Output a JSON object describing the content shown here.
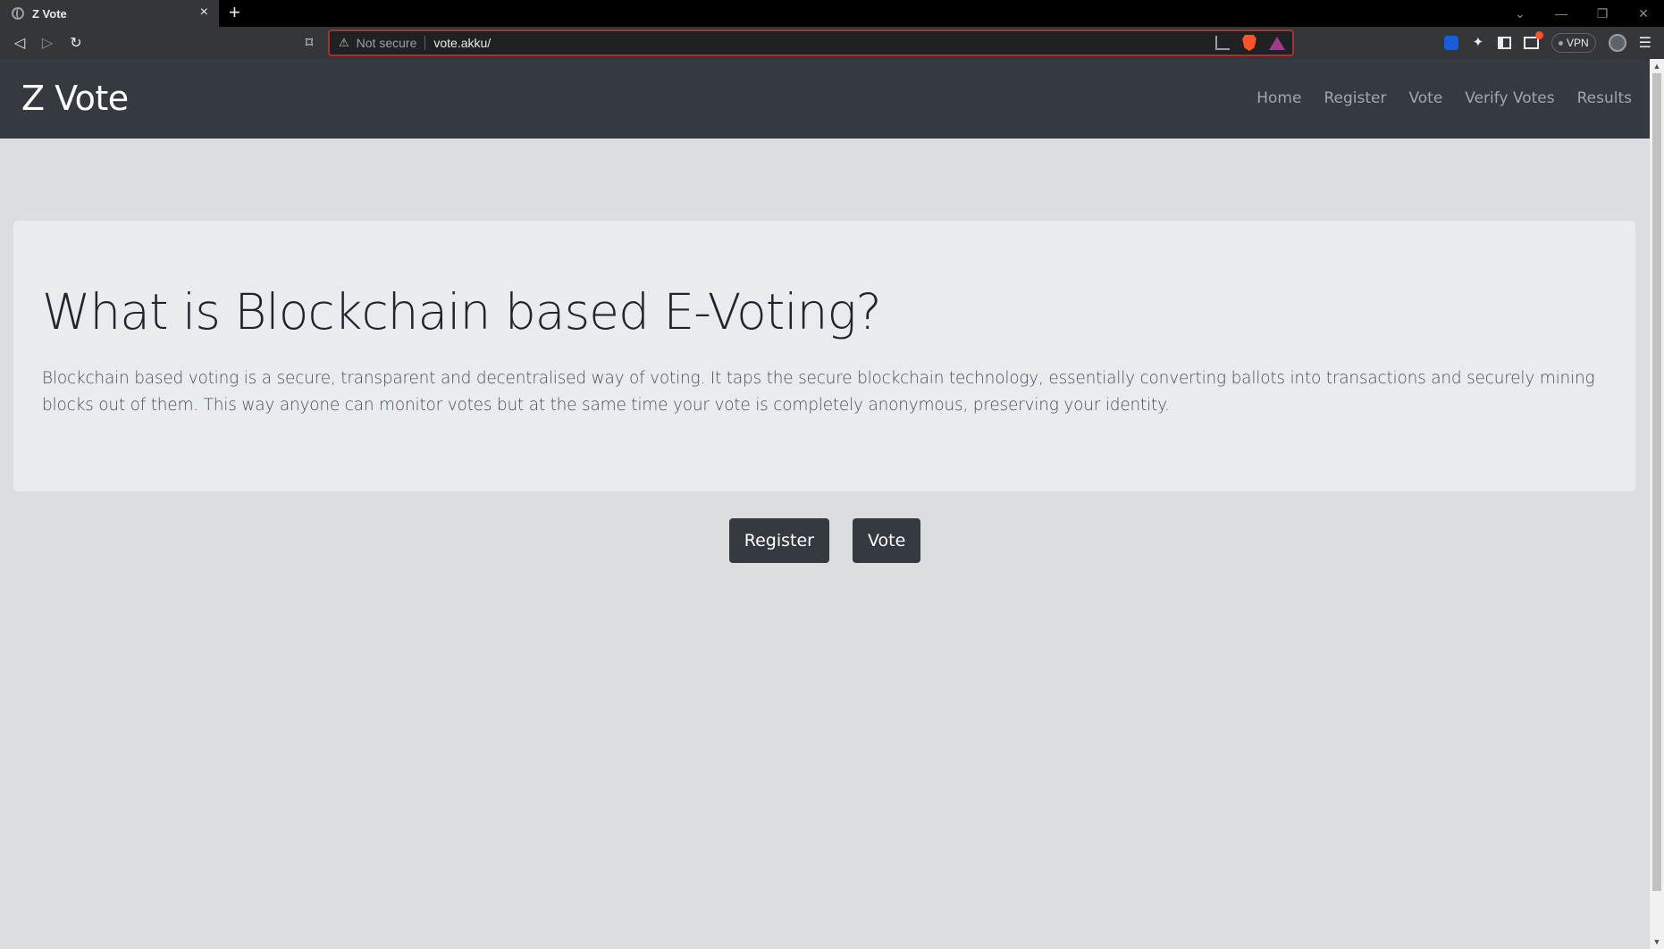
{
  "browser": {
    "tab_title": "Z Vote",
    "tab_close": "×",
    "new_tab": "+",
    "security_label": "Not secure",
    "url": "vote.akku/",
    "vpn_label": "VPN"
  },
  "site": {
    "brand": "Z Vote",
    "nav": {
      "home": "Home",
      "register": "Register",
      "vote": "Vote",
      "verify": "Verify Votes",
      "results": "Results"
    }
  },
  "hero": {
    "title": "What is Blockchain based E-Voting?",
    "description": "Blockchain based voting is a secure, transparent and decentralised way of voting. It taps the secure blockchain technology, essentially converting ballots into transactions and securely mining blocks out of them. This way anyone can monitor votes but at the same time your vote is completely anonymous, preserving your identity."
  },
  "actions": {
    "register": "Register",
    "vote": "Vote"
  }
}
